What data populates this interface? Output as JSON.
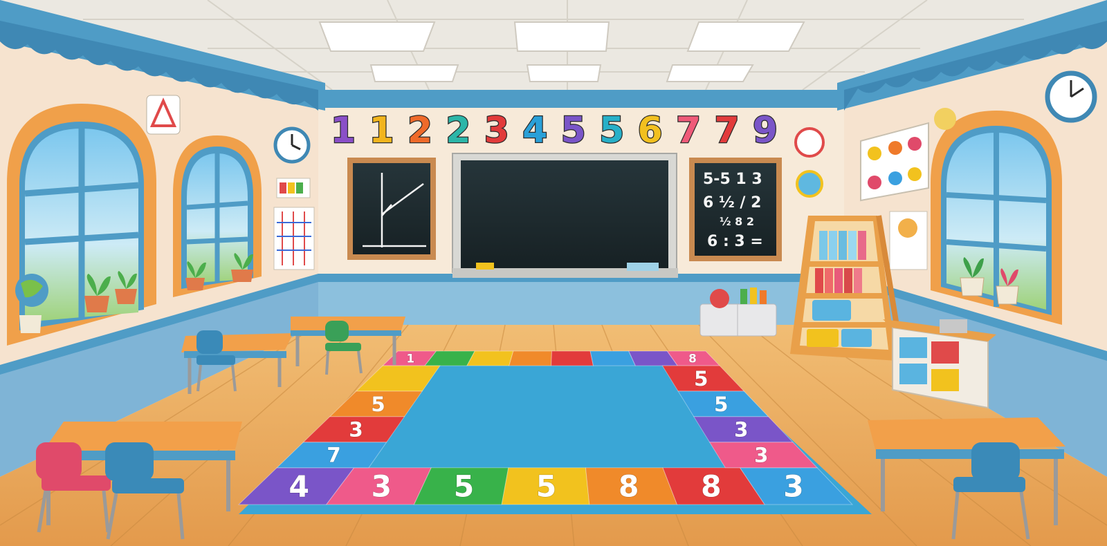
{
  "scene": {
    "type": "cartoon classroom illustration",
    "palette": {
      "wall": "#f6e3cf",
      "wall_trim": "#4f9cc6",
      "wainscot": "#7fb4d6",
      "floor": "#e7aa5e",
      "floor_dark": "#cf8e45",
      "ceiling": "#e9e6df",
      "window_frame": "#f0a04a",
      "chalkboard": "#1f2a2e",
      "mat_center": "#3aa6d6"
    }
  },
  "wall_numbers": [
    "1",
    "1",
    "2",
    "2",
    "3",
    "4",
    "5",
    "5",
    "6",
    "7",
    "7",
    "9"
  ],
  "wall_number_colors": [
    "#8a4fc8",
    "#f2b51e",
    "#ef6a2a",
    "#2cb6a8",
    "#e23b3b",
    "#2aa0d8",
    "#7a55c8",
    "#28b0c8",
    "#f2c020",
    "#ef5a78",
    "#e23b3b",
    "#7a55c8"
  ],
  "right_board_lines": [
    "5-5 1 3",
    "6 ½ / 2",
    "½ 8 2",
    "6 : 3 ="
  ],
  "mat": {
    "top_row": [
      "1",
      "",
      "",
      "",
      "",
      "",
      "",
      "8"
    ],
    "left_col": [
      "",
      "5",
      "3",
      "7"
    ],
    "right_col": [
      "5",
      "5",
      "3",
      "3"
    ],
    "bottom_row": [
      "4",
      "3",
      "5",
      "5",
      "8",
      "8",
      "3"
    ],
    "tile_colors": [
      "#ef5a8a",
      "#38b24a",
      "#f2c21e",
      "#f08a2a",
      "#e23b3b",
      "#3aa0e0",
      "#7a55c8"
    ]
  }
}
